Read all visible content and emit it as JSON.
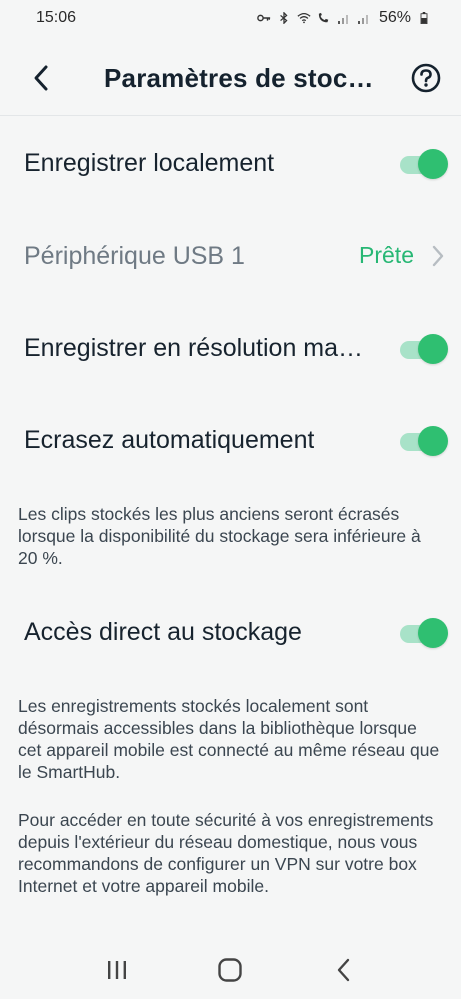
{
  "status_bar": {
    "time": "15:06",
    "battery": "56%",
    "icons": [
      "key-icon",
      "bluetooth-icon",
      "wifi-icon",
      "call-wifi-icon",
      "signal-icon",
      "signal-icon-2",
      "battery-icon"
    ]
  },
  "header": {
    "title": "Paramètres de stockage",
    "back_icon": "chevron-left-icon",
    "help_icon": "help-circle-icon"
  },
  "settings": [
    {
      "label": "Enregistrer localement",
      "type": "toggle",
      "on": true
    },
    {
      "label": "Périphérique USB 1",
      "type": "status",
      "value": "Prête",
      "muted": true
    },
    {
      "label": "Enregistrer en résolution maximale",
      "type": "toggle",
      "on": true
    },
    {
      "label": "Ecrasez automatiquement",
      "type": "toggle",
      "on": true
    },
    {
      "label": "Accès direct au stockage",
      "type": "toggle",
      "on": true
    }
  ],
  "notes": {
    "overwrite": "Les clips stockés les plus anciens seront écrasés lorsque la disponibilité du stockage sera inférieure à 20 %.",
    "direct_access_1": "Les enregistrements stockés localement sont désormais accessibles dans la bibliothèque lorsque cet appareil mobile est connecté au même réseau que le SmartHub.",
    "direct_access_2": "Pour accéder en toute sécurité à vos enregistrements depuis l'extérieur du réseau domestique, nous vous recommandons de configurer un VPN sur votre box Internet et votre appareil mobile."
  },
  "colors": {
    "accent": "#2fbf71",
    "track": "#a8e2c8",
    "background": "#f5f6f6",
    "text": "#17232e",
    "muted": "#6f7a84"
  },
  "nav_bar": {
    "icons": [
      "recents-icon",
      "home-icon",
      "back-nav-icon"
    ]
  }
}
